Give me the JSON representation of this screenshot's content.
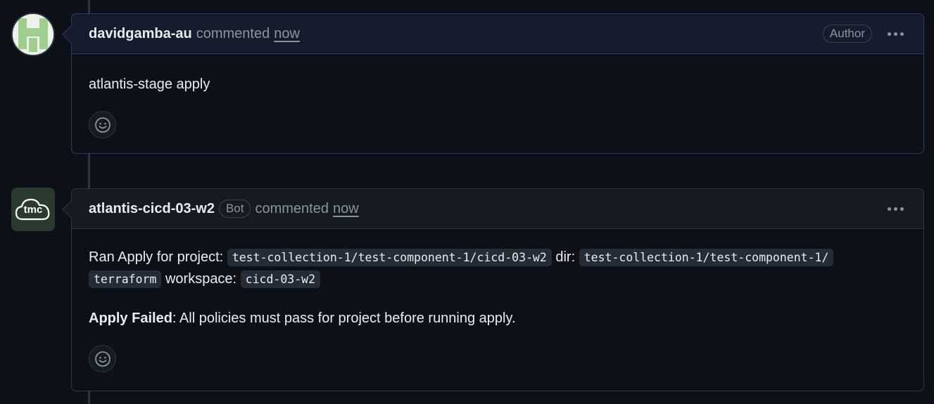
{
  "comments": [
    {
      "username": "davidgamba-au",
      "action": "commented",
      "time": "now",
      "badge": "Author",
      "body": "atlantis-stage apply"
    },
    {
      "username": "atlantis-cicd-03-w2",
      "badge": "Bot",
      "action": "commented",
      "time": "now",
      "body": {
        "prefix": "Ran Apply for project: ",
        "project": "test-collection-1/test-component-1/cicd-03-w2",
        "dir_label": " dir: ",
        "dir": "test-collection-1/test-component-1/terraform",
        "dir_part1": "test-collection-1/test-component-1/",
        "dir_part2": "terraform",
        "workspace_label": " workspace: ",
        "workspace": "cicd-03-w2",
        "failed_label": "Apply Failed",
        "failed_message": ": All policies must pass for project before running apply."
      }
    }
  ],
  "avatars": {
    "bot_text": "tmc"
  },
  "icons": [
    "smiley-icon",
    "kebab-icon"
  ],
  "colors": {
    "background": "#0d1117",
    "header": "#161b22",
    "author_border": "#2f3a6b",
    "muted": "#8b949e"
  }
}
